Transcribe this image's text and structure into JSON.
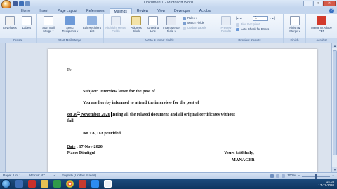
{
  "window": {
    "title": "Document1 - Microsoft Word"
  },
  "window_controls": {
    "minimize": "–",
    "maximize": "□",
    "close": "✕"
  },
  "tabs": [
    "Home",
    "Insert",
    "Page Layout",
    "References",
    "Mailings",
    "Review",
    "View",
    "Developer",
    "Acrobat"
  ],
  "active_tab": "Mailings",
  "ribbon": {
    "groups": [
      "Create",
      "Start Mail Merge",
      "Write & Insert Fields",
      "Preview Results",
      "Finish",
      "Acrobat"
    ],
    "buttons": {
      "envelopes": "Envelopes",
      "labels": "Labels",
      "start_mail_merge": "Start Mail Merge ▾",
      "select_recipients": "Select Recipients ▾",
      "edit_recipient_list": "Edit Recipient List",
      "highlight_merge_fields": "Highlight Merge Fields",
      "address_block": "Address Block",
      "greeting_line": "Greeting Line",
      "insert_merge_field": "Insert Merge Field ▾",
      "rules": "Rules ▾",
      "match_fields": "Match Fields",
      "update_labels": "Update Labels",
      "preview_results": "Preview Results",
      "find_recipient": "Find Recipient",
      "auto_check_errors": "Auto Check for Errors",
      "finish_merge": "Finish & Merge ▾",
      "merge_to_pdf": "Merge to Adobe PDF"
    },
    "record_number": "1"
  },
  "document": {
    "to": "To",
    "subject": "Subject: Interview letter for the post of",
    "body_line1": "You are hereby informed to attend the interview  for the post of",
    "body_on": "on 30",
    "body_sup": "th",
    "body_date_rest": " November 2020",
    "body_line2_rest": " Bring all the related document and all original certificates without",
    "body_line3": "fail.",
    "note": "No TA, DA provided.",
    "date_label": "Date",
    "date_value": " : 17-Nov-2020",
    "place_label": "Place: ",
    "place_value": "Dindigul",
    "yours_word": "Yours",
    "yours_rest": " faithfully,",
    "manager": "MANAGER"
  },
  "statusbar": {
    "page": "Page: 1 of 1",
    "words": "Words: 47",
    "language": "English (United States)",
    "zoom": "100%"
  },
  "taskbar": {
    "time": "14:03",
    "date": "17-11-2020"
  },
  "colors": {
    "ribbon_bg": "#dde8f6",
    "accent": "#1e3a66",
    "taskbar": "#0f3560"
  }
}
